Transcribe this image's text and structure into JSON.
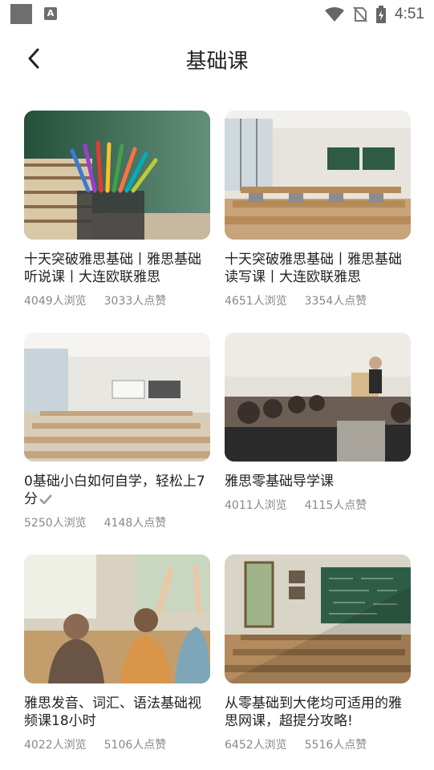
{
  "status_bar": {
    "time": "4:51"
  },
  "header": {
    "title": "基础课"
  },
  "courses": [
    {
      "title": "十天突破雅思基础丨雅思基础听说课丨大连欧联雅思",
      "views": "4049人浏览",
      "likes": "3033人点赞",
      "image": "pencils-on-books"
    },
    {
      "title": "十天突破雅思基础丨雅思基础读写课丨大连欧联雅思",
      "views": "4651人浏览",
      "likes": "3354人点赞",
      "image": "classroom-desks"
    },
    {
      "title": "0基础小白如何自学，轻松上7分",
      "views": "5250人浏览",
      "likes": "4148人点赞",
      "image": "empty-lecture-room"
    },
    {
      "title": "雅思零基础导学课",
      "views": "4011人浏览",
      "likes": "4115人点赞",
      "image": "lecture-hall-teacher"
    },
    {
      "title": "雅思发音、词汇、语法基础视频课18小时",
      "views": "4022人浏览",
      "likes": "5106人点赞",
      "image": "students-raising-hands"
    },
    {
      "title": "从零基础到大佬均可适用的雅思网课，超提分攻略!",
      "views": "6452人浏览",
      "likes": "5516人点赞",
      "image": "chalkboard-classroom"
    }
  ],
  "colors": {
    "accent_text": "#222222",
    "meta_text": "#888888",
    "chalkboard": "#2e5d47"
  }
}
